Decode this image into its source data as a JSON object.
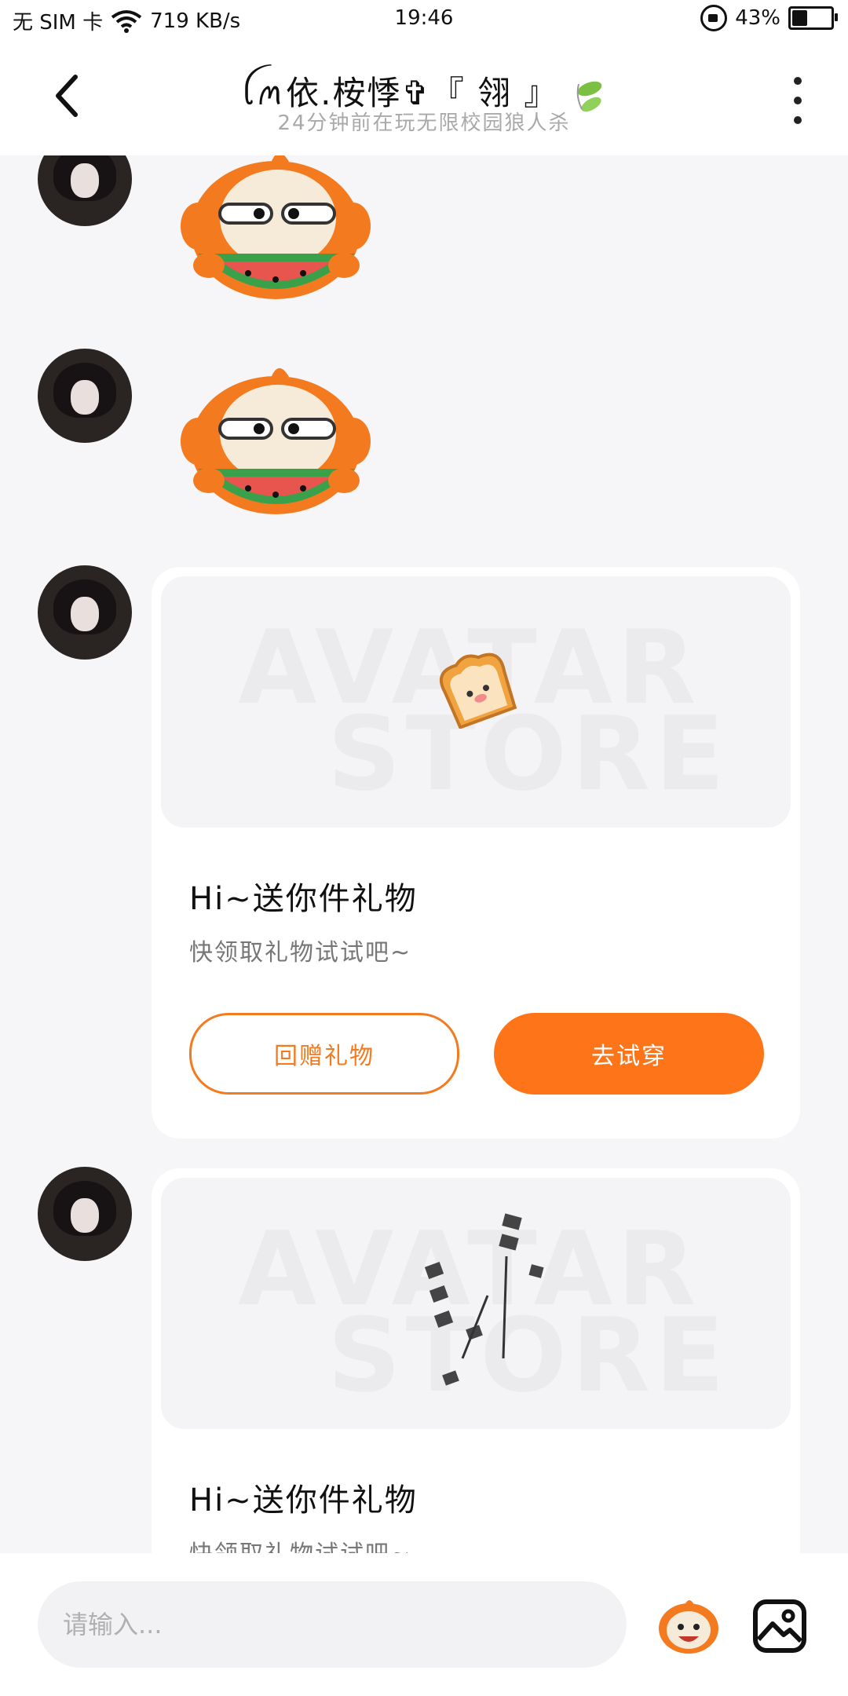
{
  "status_bar": {
    "sim": "无 SIM 卡",
    "speed": "719 KB/s",
    "time": "19:46",
    "battery": "43%",
    "battery_level": 0.43,
    "icons": [
      "wifi-icon",
      "screen-lock-icon",
      "battery-icon"
    ]
  },
  "header": {
    "title": "ꪶꪔ依.桉悸✞『 翎 』",
    "subtitle": "24分钟前在玩无限校园狼人杀",
    "icons": [
      "back-arrow-icon",
      "leaf-icon",
      "more-vertical-icon"
    ]
  },
  "messages": [
    {
      "type": "sticker",
      "icon": "melon-eating-monkey-sticker"
    },
    {
      "type": "sticker",
      "icon": "melon-eating-monkey-sticker"
    },
    {
      "type": "gift_card",
      "preview_icon": "toast-bread-icon",
      "watermark_line1": "AVATAR",
      "watermark_line2": "STORE",
      "title": "Hi~送你件礼物",
      "desc": "快领取礼物试试吧~",
      "btn_return": "回赠礼物",
      "btn_try": "去试穿"
    },
    {
      "type": "gift_card",
      "preview_icon": "hanging-tassel-charm-icon",
      "watermark_line1": "AVATAR",
      "watermark_line2": "STORE",
      "title": "Hi~送你件礼物",
      "desc": "快领取礼物试试吧~"
    }
  ],
  "input_bar": {
    "placeholder": "请输入...",
    "icons": [
      "monkey-emoji-icon",
      "image-icon"
    ]
  },
  "colors": {
    "accent": "#fe7519",
    "background": "#f6f6f8"
  }
}
